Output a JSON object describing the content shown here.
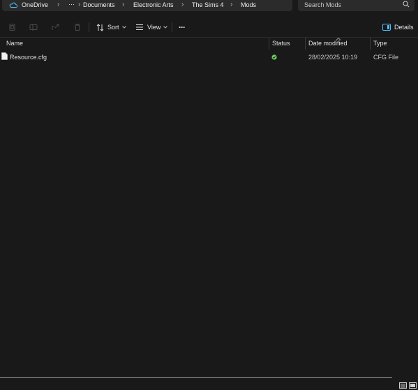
{
  "breadcrumb": {
    "root": "OneDrive",
    "overflow": "···",
    "items": [
      "Documents",
      "Electronic Arts",
      "The Sims 4",
      "Mods"
    ]
  },
  "search": {
    "placeholder": "Search Mods"
  },
  "toolbar": {
    "sort_label": "Sort",
    "view_label": "View",
    "more_label": "···",
    "details_label": "Details"
  },
  "columns": {
    "name": "Name",
    "status": "Status",
    "date": "Date modified",
    "type": "Type"
  },
  "files": [
    {
      "name": "Resource.cfg",
      "status": "synced",
      "date": "28/02/2025 10:19",
      "type": "CFG File"
    }
  ],
  "colors": {
    "background": "#191919",
    "status_ok": "#6ccb5f",
    "accent": "#4cc2ff"
  },
  "icons": [
    "cloud-icon",
    "copy-icon",
    "rename-icon",
    "share-icon",
    "delete-icon",
    "sort-icon",
    "view-icon",
    "details-pane-icon",
    "search-icon",
    "file-icon",
    "status-synced-icon",
    "details-view-icon",
    "tiles-view-icon"
  ]
}
